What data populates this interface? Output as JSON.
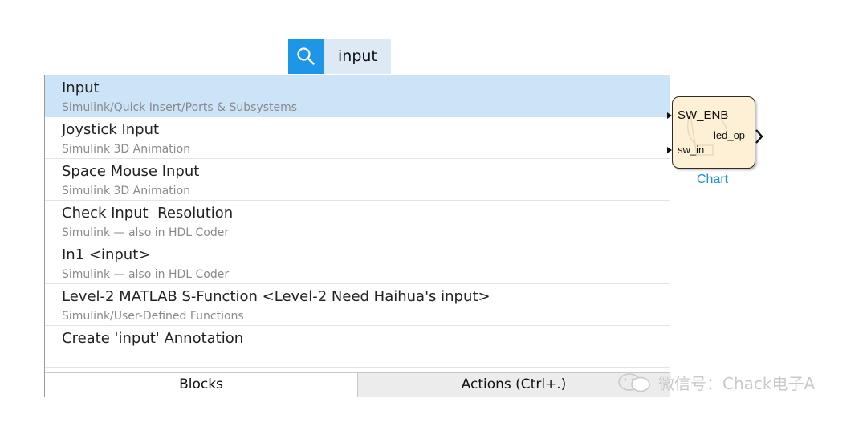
{
  "search": {
    "query": "input"
  },
  "results": [
    {
      "title": "Input",
      "subtitle": "Simulink/Quick Insert/Ports & Subsystems",
      "selected": true
    },
    {
      "title": "Joystick Input",
      "subtitle": "Simulink 3D Animation"
    },
    {
      "title": "Space Mouse Input",
      "subtitle": "Simulink 3D Animation"
    },
    {
      "title": "Check Input  Resolution",
      "subtitle": "Simulink — also in HDL Coder"
    },
    {
      "title": "In1 <input>",
      "subtitle": "Simulink — also in HDL Coder"
    },
    {
      "title": "Level-2 MATLAB S-Function <Level-2 Need Haihua's input>",
      "subtitle": "Simulink/User-Defined Functions"
    },
    {
      "title": "Create 'input' Annotation",
      "subtitle": ""
    }
  ],
  "tabs": {
    "blocks": "Blocks",
    "actions": "Actions (Ctrl+.)"
  },
  "chart_block": {
    "inputs": [
      "SW_ENB",
      "sw_in"
    ],
    "output": "led_op",
    "caption": "Chart"
  },
  "watermark": {
    "text": "微信号：Chack电子A"
  },
  "colors": {
    "accent": "#1e96e8",
    "selected_row": "#cce4f7",
    "search_field": "#ddeaf6",
    "block_fill": "#fdf0d4",
    "caption": "#1b8fe0"
  },
  "icons": {
    "search": "magnifier-icon",
    "watermark": "wechat-icon"
  }
}
